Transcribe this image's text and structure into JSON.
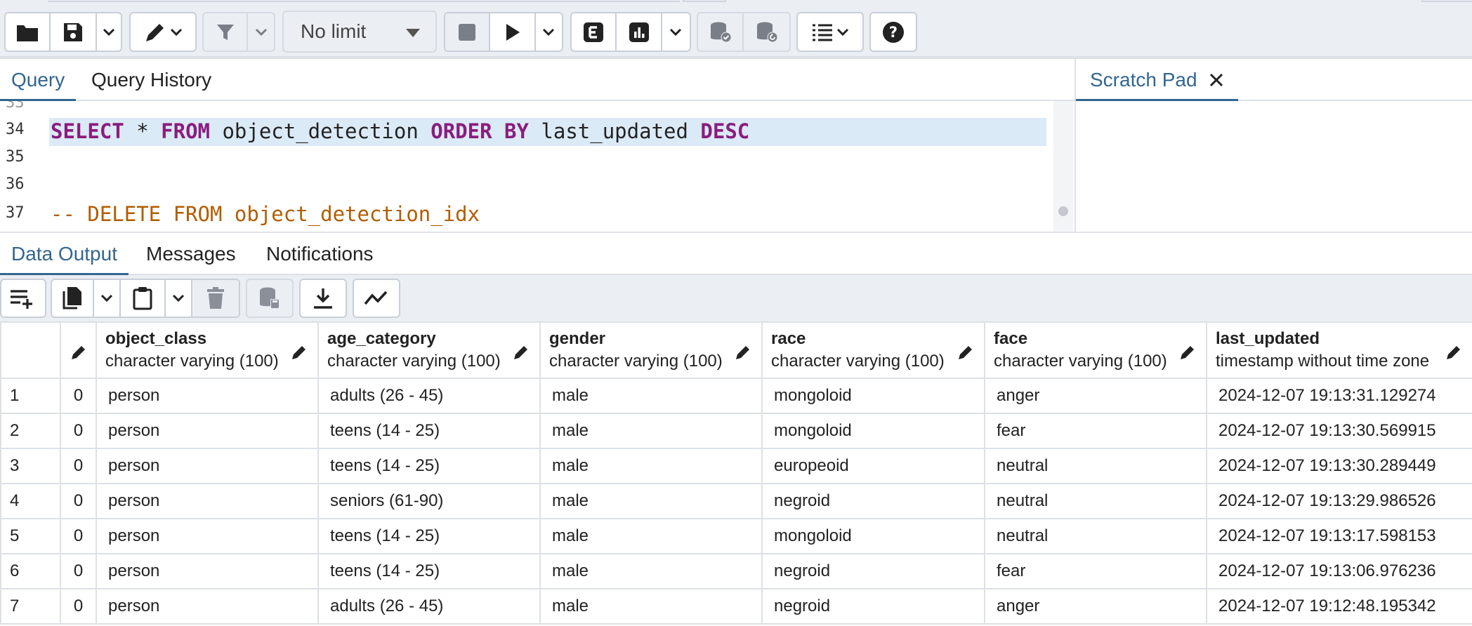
{
  "toolbar": {
    "limit_label": "No limit"
  },
  "editor_tabs": {
    "query": "Query",
    "history": "Query History",
    "scratch": "Scratch Pad"
  },
  "editor": {
    "line_numbers": [
      "34",
      "35",
      "36",
      "37"
    ],
    "line34": {
      "kw1": "SELECT",
      "t1": " * ",
      "kw2": "FROM",
      "t2": " object_detection ",
      "kw3": "ORDER BY",
      "t3": " last_updated ",
      "kw4": "DESC"
    },
    "line37": "-- DELETE FROM object_detection_idx"
  },
  "output_tabs": {
    "data": "Data Output",
    "messages": "Messages",
    "notifications": "Notifications"
  },
  "grid": {
    "columns": [
      {
        "name": "object_class",
        "type": "character varying (100)"
      },
      {
        "name": "age_category",
        "type": "character varying (100)"
      },
      {
        "name": "gender",
        "type": "character varying (100)"
      },
      {
        "name": "race",
        "type": "character varying (100)"
      },
      {
        "name": "face",
        "type": "character varying (100)"
      },
      {
        "name": "last_updated",
        "type": "timestamp without time zone"
      }
    ],
    "rows": [
      [
        "1",
        "0",
        "person",
        "adults (26 - 45)",
        "male",
        "mongoloid",
        "anger",
        "2024-12-07 19:13:31.129274"
      ],
      [
        "2",
        "0",
        "person",
        "teens (14 - 25)",
        "male",
        "mongoloid",
        "fear",
        "2024-12-07 19:13:30.569915"
      ],
      [
        "3",
        "0",
        "person",
        "teens (14 - 25)",
        "male",
        "europeoid",
        "neutral",
        "2024-12-07 19:13:30.289449"
      ],
      [
        "4",
        "0",
        "person",
        "seniors (61-90)",
        "male",
        "negroid",
        "neutral",
        "2024-12-07 19:13:29.986526"
      ],
      [
        "5",
        "0",
        "person",
        "teens (14 - 25)",
        "male",
        "mongoloid",
        "neutral",
        "2024-12-07 19:13:17.598153"
      ],
      [
        "6",
        "0",
        "person",
        "teens (14 - 25)",
        "male",
        "negroid",
        "fear",
        "2024-12-07 19:13:06.976236"
      ],
      [
        "7",
        "0",
        "person",
        "adults (26 - 45)",
        "male",
        "negroid",
        "anger",
        "2024-12-07 19:12:48.195342"
      ]
    ]
  },
  "colors": {
    "accent": "#326690",
    "keyword": "#8a1d7d",
    "comment": "#b15d00",
    "highlight": "#dbeaf7",
    "toolbar_bg": "#ebeef3"
  }
}
